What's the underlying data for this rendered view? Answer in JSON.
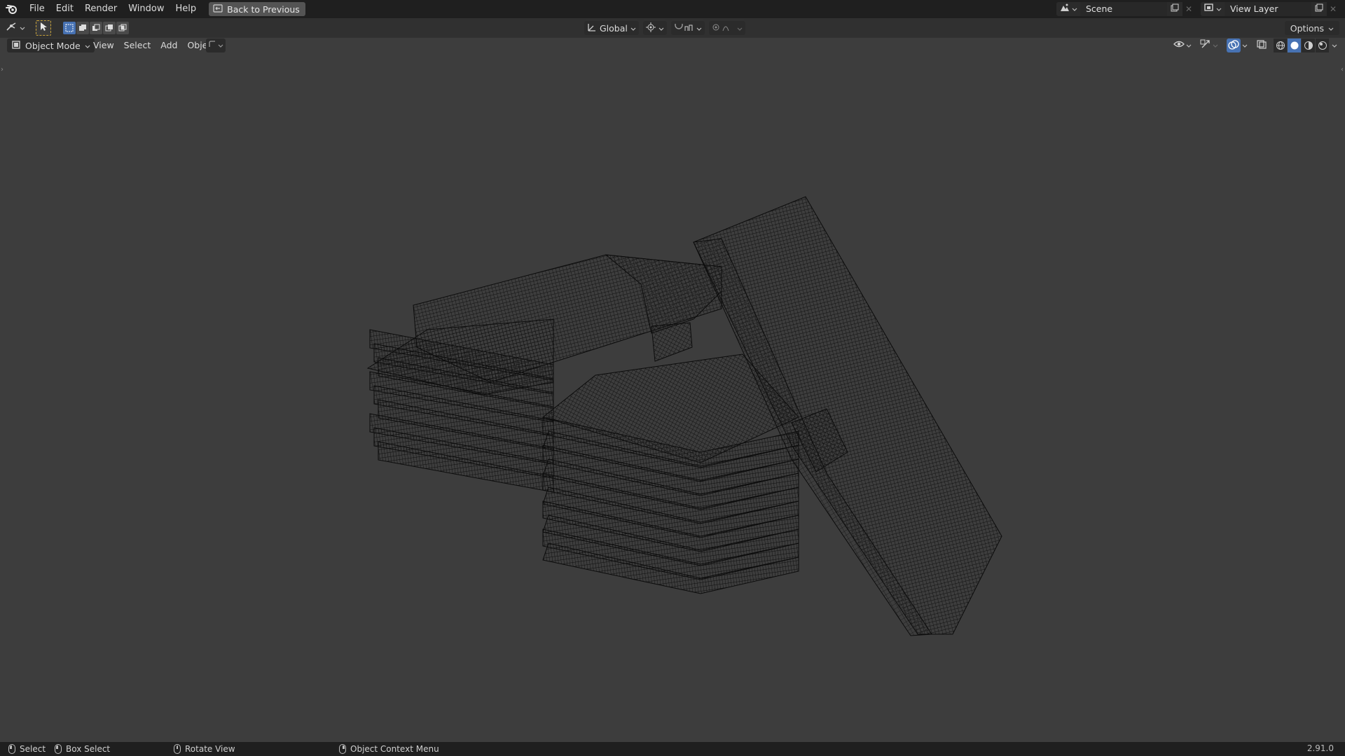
{
  "menubar": {
    "items": [
      "File",
      "Edit",
      "Render",
      "Window",
      "Help"
    ],
    "back_button": "Back to Previous"
  },
  "scene": {
    "name": "Scene"
  },
  "view_layer": {
    "name": "View Layer"
  },
  "header": {
    "transform_orientation": "Global",
    "options_label": "Options"
  },
  "viewport_header": {
    "mode": "Object Mode",
    "menus": [
      "View",
      "Select",
      "Add",
      "Object"
    ]
  },
  "statusbar": {
    "select": "Select",
    "box_select": "Box Select",
    "rotate_view": "Rotate View",
    "context_menu": "Object Context Menu",
    "version": "2.91.0"
  },
  "colors": {
    "accent": "#4772b3",
    "active_tool_outline": "#c8a23a",
    "background": "#3d3d3d",
    "wire": "#121212"
  },
  "icons": [
    "blender-logo-icon",
    "back-icon",
    "editor-type-icon",
    "select-tool-icon",
    "scene-icon",
    "view-layer-icon",
    "new-icon",
    "close-icon",
    "orientation-icon",
    "pivot-icon",
    "snap-icon",
    "proportional-icon",
    "visibility-icon",
    "gizmo-icon",
    "overlay-icon",
    "xray-icon",
    "wireframe-shading-icon",
    "solid-shading-icon",
    "material-shading-icon",
    "rendered-shading-icon",
    "mouse-left-icon",
    "mouse-middle-icon",
    "mouse-right-icon"
  ]
}
